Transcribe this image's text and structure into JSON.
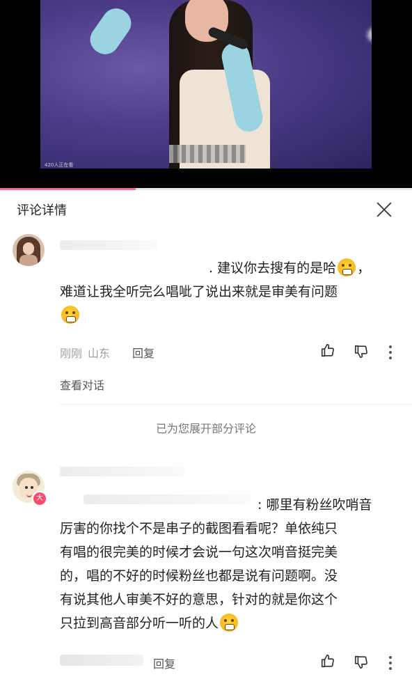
{
  "video": {
    "viewer_count_text": "420人正在看"
  },
  "progress": {
    "fraction": 0.33
  },
  "header": {
    "title": "评论详情",
    "close_icon": "close-icon"
  },
  "comments": [
    {
      "lines": [
        ". 建议你去搜有的是哈",
        "难道让我全听完么唱呲了说出来就是审美有问题"
      ],
      "meta_time": "刚刚",
      "meta_location": "山东",
      "reply_label": "回复",
      "view_conversation": "查看对话"
    },
    {
      "lines": [
        ": 哪里有粉丝吹哨音",
        "厉害的你找个不是串子的截图看看呢？单依纯只",
        "有唱的很完美的时候才会说一句这次哨音挺完美",
        "的，唱的不好的时候粉丝也都是说有问题啊。没",
        "有说其他人审美不好的意思，针对的就是你这个",
        "只拉到高音部分听一听的人"
      ],
      "badge": "大",
      "reply_label": "回复"
    }
  ],
  "expanded_notice": "已为您展开部分评论",
  "icons": {
    "like": "thumbs-up-icon",
    "dislike": "thumbs-down-icon",
    "more": "more-vertical-icon",
    "emoji": "scared-face-emoji"
  }
}
